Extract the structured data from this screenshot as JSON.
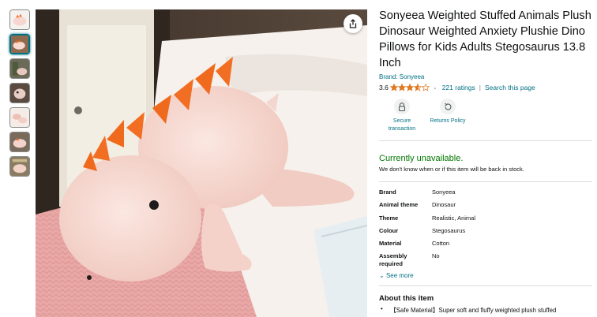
{
  "product": {
    "title": "Sonyeea Weighted Stuffed Animals Plush Dinosaur Weighted Anxiety Plushie Dino Pillows for Kids Adults Stegosaurus 13.8 Inch",
    "brand_link": "Brand: Sonyeea",
    "rating_value": "3.6",
    "rating_stars": 3.6,
    "ratings_count": "221 ratings",
    "search_page": "Search this page",
    "separator": "|"
  },
  "badges": [
    {
      "icon": "lock-icon",
      "label": "Secure transaction"
    },
    {
      "icon": "return-icon",
      "label": "Returns Policy"
    }
  ],
  "availability": {
    "status": "Currently unavailable.",
    "note": "We don't know when or if this item will be back in stock."
  },
  "specs": [
    {
      "key": "Brand",
      "value": "Sonyeea"
    },
    {
      "key": "Animal theme",
      "value": "Dinosaur"
    },
    {
      "key": "Theme",
      "value": "Realistic, Animal"
    },
    {
      "key": "Colour",
      "value": "Stegosaurus"
    },
    {
      "key": "Material",
      "value": "Cotton"
    },
    {
      "key": "Assembly required",
      "value": "No"
    }
  ],
  "see_more": "See more",
  "about": {
    "heading": "About this item",
    "bullet_1": "【Safe Material】Super soft and fluffy weighted plush stuffed"
  },
  "colors": {
    "link": "#007185",
    "available_green": "#007600",
    "star": "#de7921",
    "plush_pink": "#f7d9d2",
    "spike_orange": "#f06a1d"
  }
}
